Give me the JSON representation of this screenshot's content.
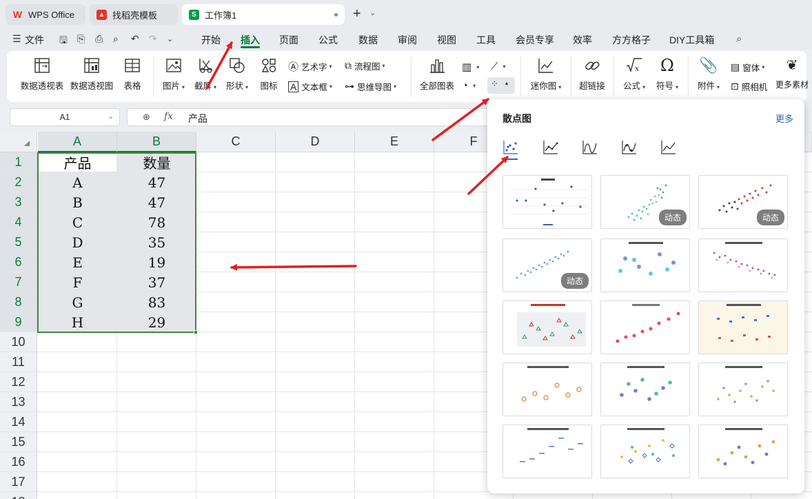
{
  "tabs": [
    {
      "label": "WPS Office",
      "color": "#e8332a"
    },
    {
      "label": "找稻壳模板",
      "color": "#e8332a"
    },
    {
      "label": "工作簿1",
      "color": "#0a9b4b",
      "letter": "S"
    }
  ],
  "menu": {
    "file": "文件",
    "items": [
      "开始",
      "插入",
      "页面",
      "公式",
      "数据",
      "审阅",
      "视图",
      "工具",
      "会员专享",
      "效率",
      "方方格子",
      "DIY工具箱"
    ],
    "active": "插入"
  },
  "ribbon": {
    "pivot_table": "数据透视表",
    "pivot_chart": "数据透视图",
    "table": "表格",
    "picture": "图片",
    "screenshot": "截屏",
    "shape": "形状",
    "icon": "图标",
    "wordart": "艺术字",
    "textbox": "文本框",
    "flowchart": "流程图",
    "mindmap": "思维导图",
    "all_charts": "全部图表",
    "sparkline": "迷你图",
    "hyperlink": "超链接",
    "formula": "公式",
    "symbol": "符号",
    "attachment": "附件",
    "form": "窗体",
    "camera": "照相机",
    "more_material": "更多素材"
  },
  "formula_bar": {
    "cell_ref": "A1",
    "fx": "fx",
    "content": "产品"
  },
  "columns": [
    "A",
    "B",
    "C",
    "D",
    "E",
    "F"
  ],
  "rows": [
    "1",
    "2",
    "3",
    "4",
    "5",
    "6",
    "7",
    "8",
    "9",
    "10",
    "11",
    "12",
    "13",
    "14",
    "15",
    "16",
    "17",
    "18"
  ],
  "table": {
    "headers": [
      "产品",
      "数量"
    ],
    "data": [
      [
        "A",
        "47"
      ],
      [
        "B",
        "47"
      ],
      [
        "C",
        "78"
      ],
      [
        "D",
        "35"
      ],
      [
        "E",
        "19"
      ],
      [
        "F",
        "37"
      ],
      [
        "G",
        "83"
      ],
      [
        "H",
        "29"
      ]
    ]
  },
  "popup": {
    "title": "散点图",
    "more": "更多",
    "badge": "动态",
    "accent": "#2b63c6"
  },
  "colors": {
    "accent_green": "#0a7b3c",
    "arrow_red": "#e02020"
  }
}
